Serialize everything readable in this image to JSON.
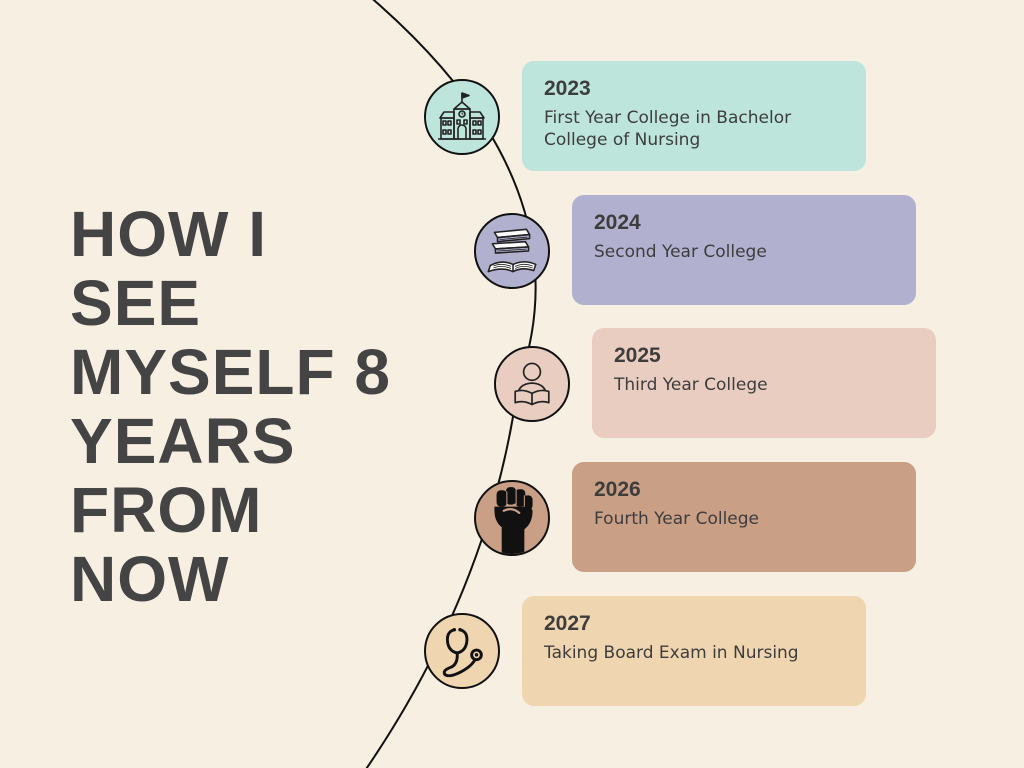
{
  "headline": {
    "lines": [
      "HOW I",
      "SEE",
      "MYSELF 8",
      "YEARS",
      "FROM",
      "NOW"
    ]
  },
  "timeline": [
    {
      "year": "2023",
      "description": "First Year College in Bachelor College of Nursing",
      "icon": "school-building-icon",
      "card_color": "#bde5dc",
      "node_color": "#bde5dc"
    },
    {
      "year": "2024",
      "description": "Second Year College",
      "icon": "books-icon",
      "card_color": "#b1b1cf",
      "node_color": "#b1b1cf"
    },
    {
      "year": "2025",
      "description": "Third Year College",
      "icon": "student-reading-icon",
      "card_color": "#e8cdc0",
      "node_color": "#e8cdc0"
    },
    {
      "year": "2026",
      "description": "Fourth Year College",
      "icon": "raised-fist-icon",
      "card_color": "#c99f85",
      "node_color": "#c99f85"
    },
    {
      "year": "2027",
      "description": "Taking Board Exam in Nursing",
      "icon": "stethoscope-icon",
      "card_color": "#f0d6b0",
      "node_color": "#f0d6b0"
    }
  ],
  "colors": {
    "background": "#f7efe2",
    "text": "#3d3d3d",
    "line": "#111111"
  }
}
